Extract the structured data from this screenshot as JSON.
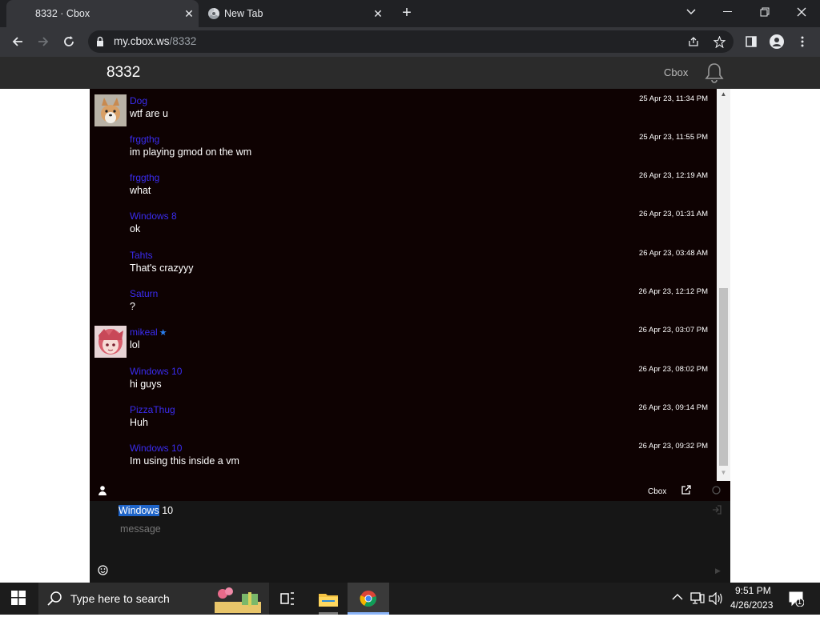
{
  "browser": {
    "tabs": [
      {
        "title": "8332 · Cbox",
        "close": "✕"
      },
      {
        "title": "New Tab",
        "close": "✕"
      }
    ],
    "new_tab": "+",
    "url_host": "my.cbox.ws",
    "url_path": "/8332",
    "window_controls": {
      "dropdown": "⌄",
      "minimize": "—",
      "restore": "❐",
      "close": "✕"
    }
  },
  "page": {
    "title": "8332",
    "brand": "Cbox"
  },
  "messages": [
    {
      "user": "Dog",
      "text": "wtf are u",
      "time": "25 Apr 23, 11:34 PM",
      "avatar": "dog-avatar"
    },
    {
      "user": "frggthg",
      "text": "im playing gmod on the wm",
      "time": "25 Apr 23, 11:55 PM"
    },
    {
      "user": "frggthg",
      "text": "what",
      "time": "26 Apr 23, 12:19 AM"
    },
    {
      "user": "Windows 8",
      "text": "ok",
      "time": "26 Apr 23, 01:31 AM"
    },
    {
      "user": "Tahts",
      "text": "That's crazyyy",
      "time": "26 Apr 23, 03:48 AM"
    },
    {
      "user": "Saturn",
      "text": "?",
      "time": "26 Apr 23, 12:12 PM"
    },
    {
      "user": "mikeal",
      "text": "lol",
      "time": "26 Apr 23, 03:07 PM",
      "avatar": "anime-avatar",
      "starred": true
    },
    {
      "user": "Windows 10",
      "text": "hi guys",
      "time": "26 Apr 23, 08:02 PM"
    },
    {
      "user": "PizzaThug",
      "text": "Huh",
      "time": "26 Apr 23, 09:14 PM"
    },
    {
      "user": "Windows 10",
      "text": "Im using this inside a vm",
      "time": "26 Apr 23, 09:32 PM"
    }
  ],
  "chatbar": {
    "label": "Cbox"
  },
  "post": {
    "name_selected": "Windows",
    "name_rest": " 10",
    "message_placeholder": "message"
  },
  "taskbar": {
    "search_text": "Type here to search",
    "time": "9:51 PM",
    "date": "4/26/2023",
    "notification_count": "1"
  }
}
